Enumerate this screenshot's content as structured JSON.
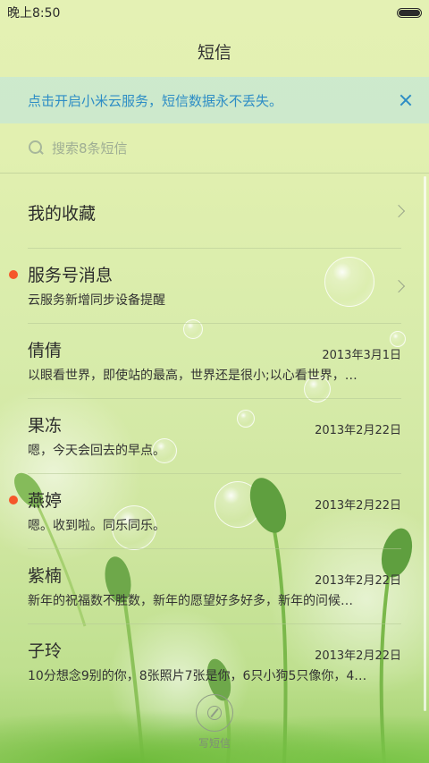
{
  "status_bar": {
    "time": "晚上8:50",
    "battery_level": 1.0
  },
  "header": {
    "title": "短信"
  },
  "banner": {
    "text": "点击开启小米云服务，短信数据永不丢失。",
    "accent_color": "#2d8dc5"
  },
  "search": {
    "placeholder": "搜索8条短信"
  },
  "favorites": {
    "label": "我的收藏"
  },
  "conversations": [
    {
      "name": "服务号消息",
      "date": "",
      "preview": "云服务新增同步设备提醒",
      "unread": true
    },
    {
      "name": "倩倩",
      "date": "2013年3月1日",
      "preview": "以眼看世界，即使站的最高，世界还是很小;以心看世界，…",
      "unread": false
    },
    {
      "name": "果冻",
      "date": "2013年2月22日",
      "preview": "嗯，今天会回去的早点。",
      "unread": false
    },
    {
      "name": "燕婷",
      "date": "2013年2月22日",
      "preview": "嗯。收到啦。同乐同乐。",
      "unread": true
    },
    {
      "name": "紫楠",
      "date": "2013年2月22日",
      "preview": "新年的祝福数不胜数，新年的愿望好多好多，新年的问候…",
      "unread": false
    },
    {
      "name": "子玲",
      "date": "2013年2月22日",
      "preview": "10分想念9别的你，8张照片7张是你，6只小狗5只像你，4…",
      "unread": false
    }
  ],
  "compose": {
    "label": "写短信"
  },
  "colors": {
    "unread_dot": "#f5572a"
  }
}
